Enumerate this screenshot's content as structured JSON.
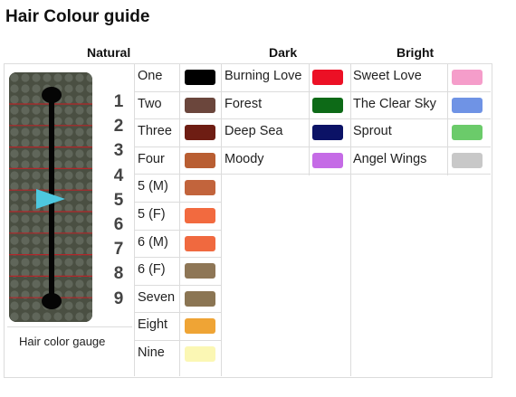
{
  "title": "Hair Colour guide",
  "headers": {
    "natural": "Natural",
    "dark": "Dark",
    "bright": "Bright"
  },
  "gauge": {
    "caption": "Hair color gauge",
    "numbers": [
      "1",
      "2",
      "3",
      "4",
      "5",
      "6",
      "7",
      "8",
      "9"
    ],
    "marker_level": 5,
    "marker_color": "#4dc8e0"
  },
  "natural": [
    {
      "label": "One",
      "color": "#000000"
    },
    {
      "label": "Two",
      "color": "#6b463c"
    },
    {
      "label": "Three",
      "color": "#6e1d13"
    },
    {
      "label": "Four",
      "color": "#b95e32"
    },
    {
      "label": "5 (M)",
      "color": "#c2643c"
    },
    {
      "label": "5 (F)",
      "color": "#f26a3f"
    },
    {
      "label": "6 (M)",
      "color": "#f0693f"
    },
    {
      "label": "6 (F)",
      "color": "#8e7656"
    },
    {
      "label": "Seven",
      "color": "#8b7553"
    },
    {
      "label": "Eight",
      "color": "#efa435"
    },
    {
      "label": "Nine",
      "color": "#fbf7b4"
    }
  ],
  "dark": [
    {
      "label": "Burning Love",
      "color": "#ec1025"
    },
    {
      "label": "Forest",
      "color": "#0d6a17"
    },
    {
      "label": "Deep Sea",
      "color": "#0b1266"
    },
    {
      "label": "Moody",
      "color": "#c56be6"
    }
  ],
  "bright": [
    {
      "label": "Sweet Love",
      "color": "#f59dca"
    },
    {
      "label": "The Clear Sky",
      "color": "#6f93e5"
    },
    {
      "label": "Sprout",
      "color": "#6bcb6a"
    },
    {
      "label": "Angel Wings",
      "color": "#c8c8c8"
    }
  ]
}
